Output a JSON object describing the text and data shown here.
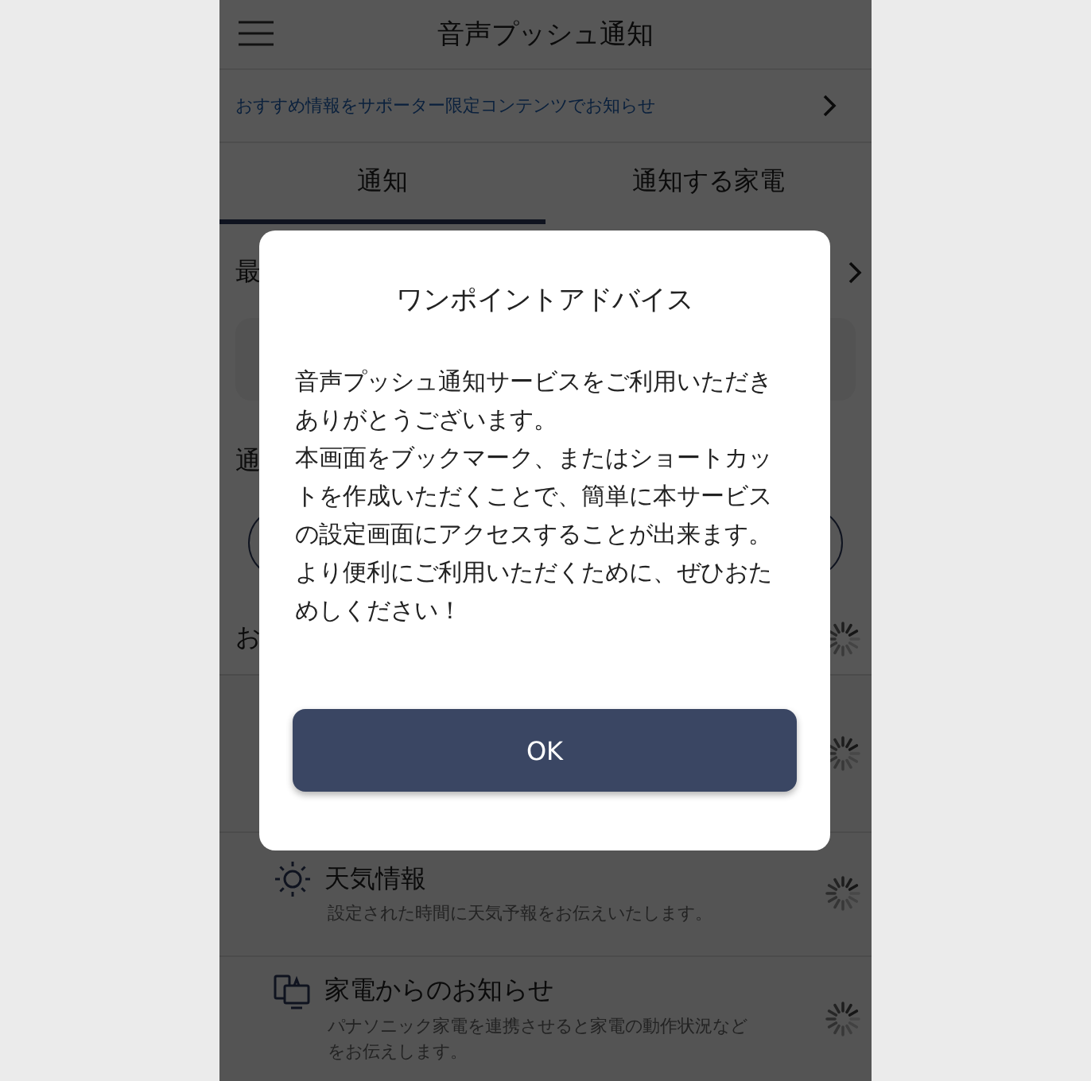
{
  "header": {
    "title": "音声プッシュ通知"
  },
  "banner": {
    "text": "おすすめ情報をサポーター限定コンテンツでお知らせ"
  },
  "tabs": [
    {
      "label": "通知",
      "selected": true
    },
    {
      "label": "通知する家電",
      "selected": false
    }
  ],
  "sections": [
    {
      "label": "最"
    },
    {
      "label": "通"
    },
    {
      "label": "お"
    }
  ],
  "notifications": [
    {
      "kind": "covered"
    },
    {
      "kind": "weather",
      "title": "天気情報",
      "description": "設定された時間に天気予報をお伝えいたします。"
    },
    {
      "kind": "appliance",
      "title": "家電からのお知らせ",
      "description": "パナソニック家電を連携させると家電の動作状況などをお伝えします。"
    }
  ],
  "dialog": {
    "title": "ワンポイントアドバイス",
    "paragraphs": [
      "音声プッシュ通知サービスをご利用いただきありがとうございます。",
      "本画面をブックマーク、またはショートカットを作成いただくことで、簡単に本サービスの設定画面にアクセスすることが出来ます。",
      "より便利にご利用いただくために、ぜひおためしください！"
    ],
    "button": "OK"
  }
}
